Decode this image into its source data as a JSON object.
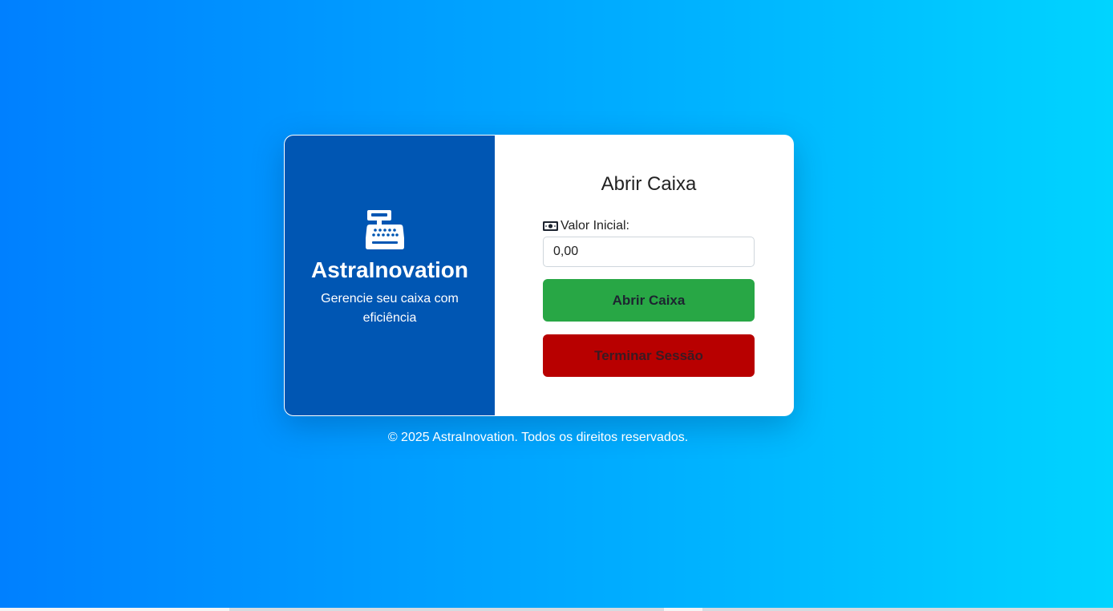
{
  "brand": {
    "icon": "cash-register-icon",
    "name": "AstraInovation",
    "tagline": "Gerencie seu caixa com eficiência"
  },
  "form": {
    "title": "Abrir Caixa",
    "label_icon": "money-bill-icon",
    "label": "Valor Inicial:",
    "input_value": "0,00",
    "open_button": "Abrir Caixa",
    "logout_button": "Terminar Sessão"
  },
  "footer": {
    "text": "© 2025 AstraInovation. Todos os direitos reservados."
  },
  "colors": {
    "background_start": "#0080ff",
    "background_end": "#00d4ff",
    "brand_panel": "#0056b3",
    "open_button": "#28a745",
    "logout_button": "#b80000"
  }
}
